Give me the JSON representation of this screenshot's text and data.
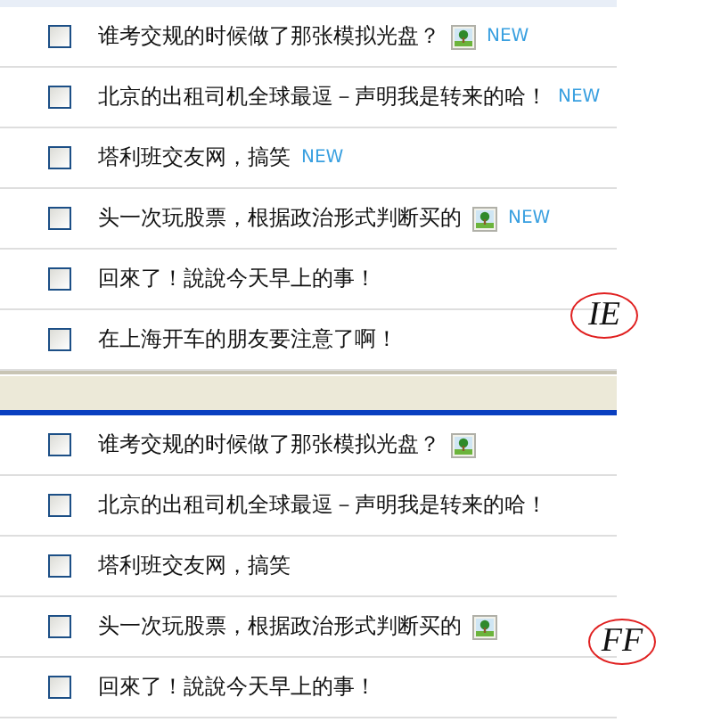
{
  "panels": [
    {
      "label": "IE",
      "rows": [
        {
          "text": "谁考交规的时候做了那张模拟光盘？",
          "checked": false,
          "has_image": true,
          "badge": "NEW"
        },
        {
          "text": "北京的出租司机全球最逗－声明我是转来的哈！",
          "checked": false,
          "has_image": false,
          "badge": "NEW"
        },
        {
          "text": "塔利班交友网，搞笑",
          "checked": false,
          "has_image": false,
          "badge": "NEW"
        },
        {
          "text": "头一次玩股票，根据政治形式判断买的",
          "checked": false,
          "has_image": true,
          "badge": "NEW"
        },
        {
          "text": "回來了！說說今天早上的事！",
          "checked": false,
          "has_image": false
        },
        {
          "text": "在上海开车的朋友要注意了啊！",
          "checked": false,
          "has_image": false
        }
      ]
    },
    {
      "label": "FF",
      "rows": [
        {
          "text": "谁考交规的时候做了那张模拟光盘？",
          "checked": false,
          "has_image": true
        },
        {
          "text": "北京的出租司机全球最逗－声明我是转来的哈！",
          "checked": false,
          "has_image": false
        },
        {
          "text": "塔利班交友网，搞笑",
          "checked": false,
          "has_image": false
        },
        {
          "text": "头一次玩股票，根据政治形式判断买的",
          "checked": false,
          "has_image": true
        },
        {
          "text": "回來了！說說今天早上的事！",
          "checked": false,
          "has_image": false
        }
      ]
    }
  ]
}
